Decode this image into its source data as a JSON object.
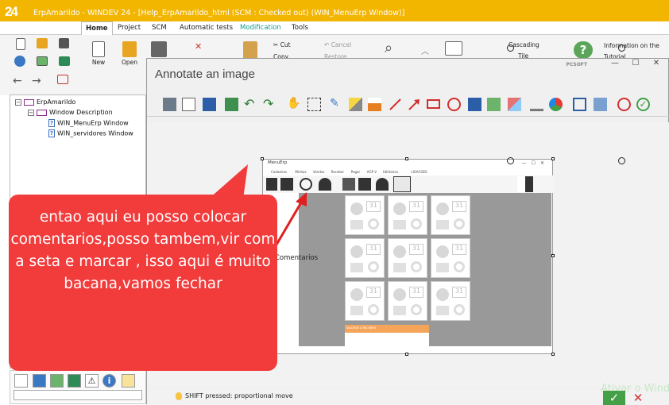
{
  "window": {
    "title": "ErpAmarildo - WINDEV 24 - [Help_ErpAmarildo_html (SCM : Checked out) (WIN_MenuErp Window)]"
  },
  "menu": {
    "tabs": [
      {
        "label": "Home"
      },
      {
        "label": "Project"
      },
      {
        "label": "SCM"
      },
      {
        "label": "Automatic tests"
      },
      {
        "label": "Modification"
      },
      {
        "label": "Tools"
      }
    ]
  },
  "ribbon": {
    "new_label": "New",
    "open_label": "Open",
    "cut_label": "Cut",
    "copy_label": "Copy",
    "cancel_label": "Cancel",
    "restore_label": "Restore",
    "cascading_label": "Cascading",
    "tile_label": "Tile",
    "info_label": "Information on the",
    "tutorial_label": "Tutorial"
  },
  "tree": {
    "nodes": [
      {
        "label": "ErpAmarildo"
      },
      {
        "label": "Window Description"
      },
      {
        "label": "WIN_MenuErp Window"
      },
      {
        "label": "WIN_servidores Window"
      }
    ]
  },
  "dialog": {
    "title": "Annotate an image",
    "brand": "PCSOFT",
    "status": "SHIFT pressed: proportional move",
    "watermark": "Ativar o Wind"
  },
  "annotated_image": {
    "window_title": "MenuErp",
    "menu_items": [
      "Cadastros",
      "Minhas",
      "Vendas",
      "Receber",
      "Pagar",
      "AGP V",
      "Utilitarios",
      "LIGACOES"
    ],
    "footer_label": "VALORES A RECEBER"
  },
  "annotation": {
    "comment_text": "Comentarios",
    "callout_text": "entao aqui eu posso colocar comentarios,posso tambem,vir com a seta e marcar , isso aqui é muito bacana,vamos fechar"
  },
  "colors": {
    "title_bar": "#f2b500",
    "callout": "#f23b3b",
    "arrow": "#e02020",
    "modification_tab": "#1a9b8f"
  }
}
